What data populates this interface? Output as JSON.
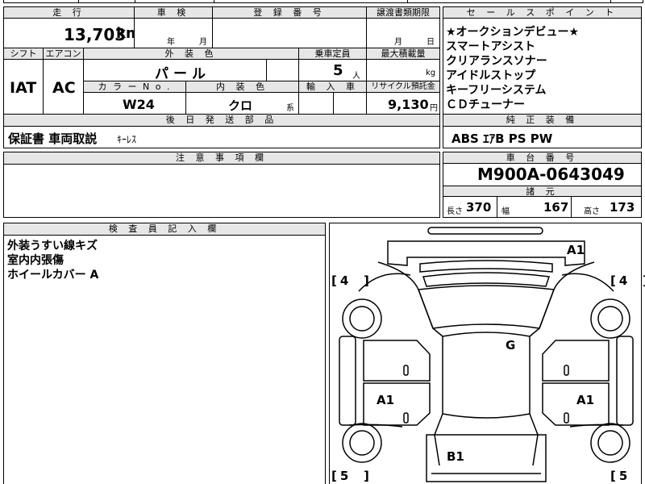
{
  "sheet": {
    "headers": {
      "mileage": "走 行",
      "inspection": "車 検",
      "registration": "登 録 番 号",
      "transfer_deadline": "譲渡書類期限",
      "sales_points": "セ ー ル ス ポ イ ン ト",
      "shift": "シフト",
      "aircon": "エアコン",
      "exterior_color": "外 装 色",
      "capacity": "乗車定員",
      "max_load": "最大積載量",
      "color_no": "カ ラ ー N o .",
      "interior_color": "内 装 色",
      "import": "輸 入 車",
      "recycle_fee": "リサイクル預託金",
      "later_parts": "後 日 発 送 部 品",
      "genuine_equipment": "純 正 装 備",
      "notes": "注 意 事 項 欄",
      "chassis_no": "車 台 番 号",
      "specs": "諸 元",
      "inspector_notes": "検 査 員 記 入 欄"
    },
    "mileage_value": "13,703",
    "mileage_unit": "km",
    "inspection_year": "年",
    "inspection_month": "月",
    "transfer_month": "月",
    "transfer_day": "日",
    "shift_value": "IAT",
    "aircon_value": "AC",
    "exterior_color_value": "パール",
    "capacity_value": "5",
    "capacity_unit": "人",
    "max_load_unit": "kg",
    "color_no_value": "W24",
    "interior_color_value": "クロ",
    "interior_color_suffix": "系",
    "recycle_fee_value": "9,130",
    "recycle_fee_unit": "円",
    "sales_points": [
      "★オークションデビュー★",
      "スマートアシスト",
      "クリアランスソナー",
      "アイドルストップ",
      "キーフリーシステム",
      "ＣＤチューナー"
    ],
    "later_parts_value": "保証書 車両取説",
    "later_parts_extra": "ｷｰﾚｽ",
    "genuine_equipment_value": "ABS ｴｱB PS PW",
    "chassis_no_value": "M900A-0643049",
    "length_label": "長さ",
    "length_value": "370",
    "width_label": "幅",
    "width_value": "167",
    "height_label": "高さ",
    "height_value": "173",
    "inspector_notes": [
      "外装うすい線キズ",
      "室内内張傷",
      "ホイールカバー A"
    ]
  },
  "diagram": {
    "marks": {
      "front_right": "A1",
      "roof": "G",
      "left_side": "A1",
      "right_side": "A1",
      "rear": "B1"
    },
    "tires": {
      "front_left": "4",
      "front_right": "4",
      "rear_left": "5",
      "rear_right": "5"
    }
  }
}
